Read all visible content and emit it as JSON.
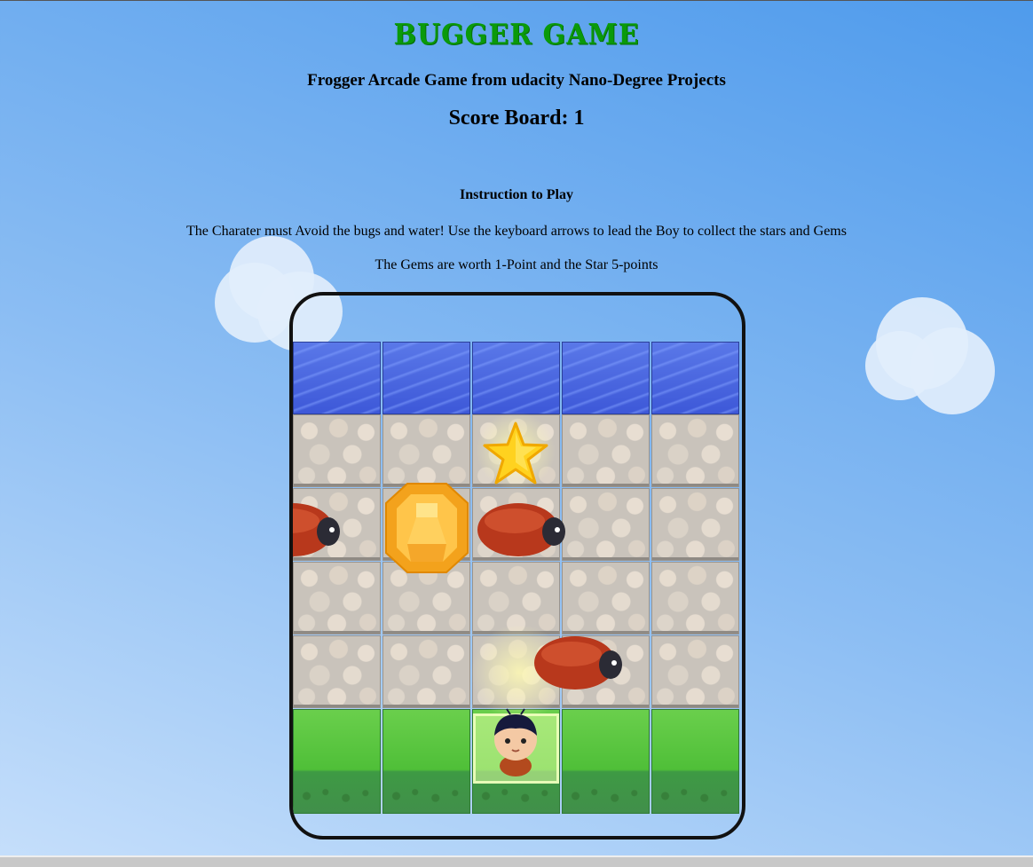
{
  "header": {
    "title": "BUGGER GAME",
    "subtitle": "Frogger Arcade Game from udacity Nano-Degree Projects",
    "score_label": "Score Board:",
    "score_value": "1"
  },
  "instructions": {
    "heading": "Instruction to Play",
    "line1": "The Charater must Avoid the bugs and water! Use the keyboard arrows to lead the Boy to collect the stars and Gems",
    "line2": "The Gems are worth 1-Point and the Star 5-points"
  },
  "board": {
    "columns": 5,
    "rows": [
      "water",
      "stone",
      "stone",
      "stone",
      "stone",
      "grass"
    ],
    "entities": [
      {
        "type": "star-icon",
        "col": 2,
        "row": 1
      },
      {
        "type": "gem-icon",
        "col": 1,
        "row": 2,
        "color": "#f5a623"
      },
      {
        "type": "bug-enemy",
        "col": 0,
        "row": 2
      },
      {
        "type": "bug-enemy",
        "col": 2,
        "row": 2
      },
      {
        "type": "bug-enemy",
        "col": 3,
        "row": 4
      },
      {
        "type": "player-boy",
        "col": 2,
        "row": 5
      }
    ]
  },
  "colors": {
    "title": "#0a9a0a",
    "background_top": "#4f9bec",
    "background_bottom": "#c6dffb"
  }
}
